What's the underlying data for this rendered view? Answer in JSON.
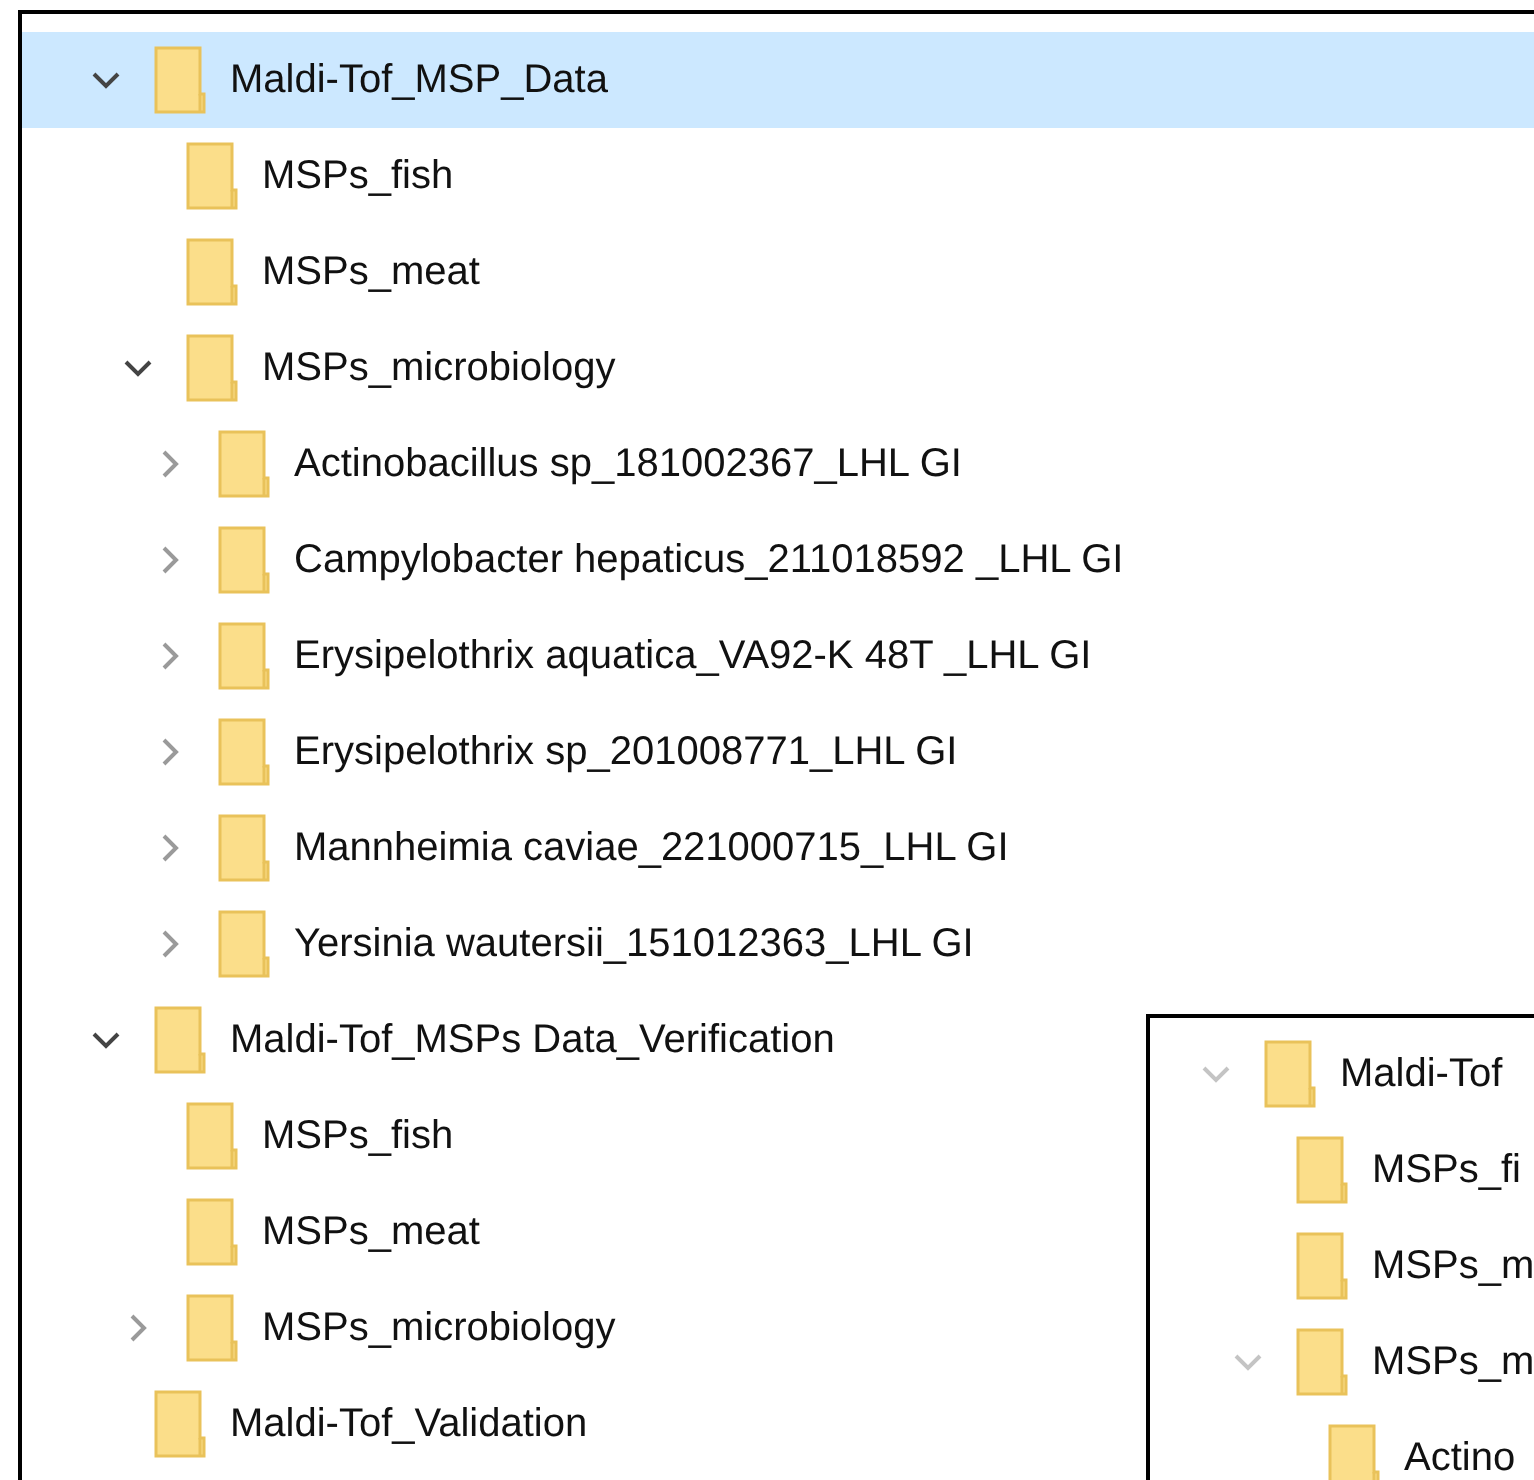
{
  "tree": [
    {
      "label": "Maldi-Tof_MSP_Data",
      "selected": true,
      "expanded": true,
      "children": [
        {
          "label": "MSPs_fish",
          "selected": false
        },
        {
          "label": "MSPs_meat",
          "selected": false
        },
        {
          "label": "MSPs_microbiology",
          "selected": false,
          "expanded": true,
          "children": [
            {
              "label": "Actinobacillus sp_181002367_LHL GI",
              "selected": false,
              "expanded": false
            },
            {
              "label": "Campylobacter hepaticus_211018592 _LHL GI",
              "selected": false,
              "expanded": false
            },
            {
              "label": "Erysipelothrix aquatica_VA92-K 48T _LHL GI",
              "selected": false,
              "expanded": false
            },
            {
              "label": "Erysipelothrix sp_201008771_LHL GI",
              "selected": false,
              "expanded": false
            },
            {
              "label": "Mannheimia caviae_221000715_LHL GI",
              "selected": false,
              "expanded": false
            },
            {
              "label": "Yersinia wautersii_151012363_LHL GI",
              "selected": false,
              "expanded": false
            }
          ]
        }
      ]
    },
    {
      "label": "Maldi-Tof_MSPs Data_Verification",
      "selected": false,
      "expanded": true,
      "children": [
        {
          "label": "MSPs_fish",
          "selected": false
        },
        {
          "label": "MSPs_meat",
          "selected": false
        },
        {
          "label": "MSPs_microbiology",
          "selected": false,
          "expanded": false
        }
      ]
    },
    {
      "label": "Maldi-Tof_Validation",
      "selected": false
    }
  ],
  "inset_tree": [
    {
      "label": "Maldi-Tof",
      "selected": false,
      "expanded": true,
      "children": [
        {
          "label": "MSPs_fi",
          "selected": false
        },
        {
          "label": "MSPs_m",
          "selected": false
        },
        {
          "label": "MSPs_m",
          "selected": false,
          "expanded": true,
          "children": [
            {
              "label": "Actino",
              "selected": false
            }
          ]
        }
      ]
    }
  ]
}
